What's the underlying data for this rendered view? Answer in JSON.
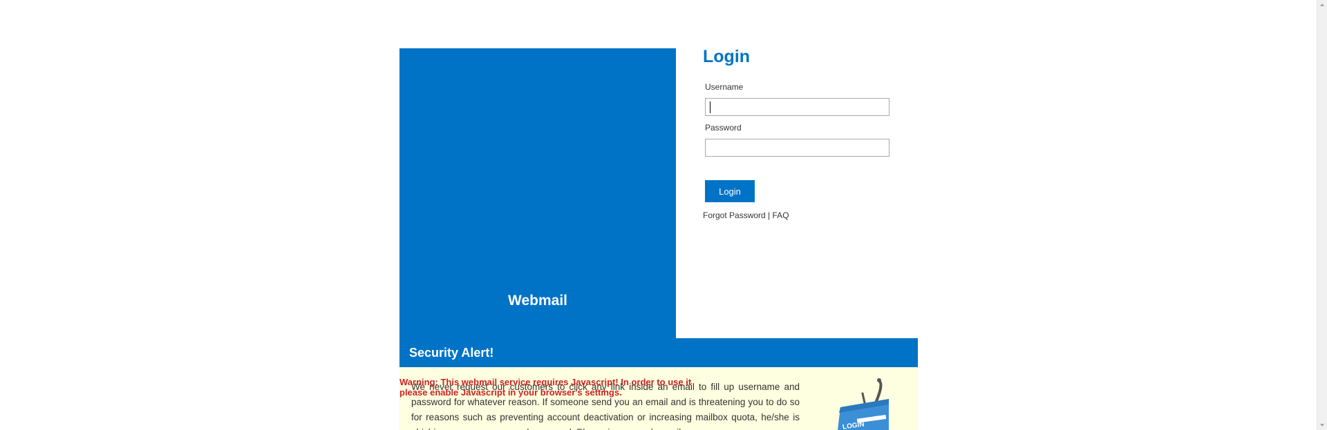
{
  "brand": {
    "title": "Webmail",
    "color": "#0073c6"
  },
  "login": {
    "title": "Login",
    "username_label": "Username",
    "username_value": "",
    "password_label": "Password",
    "password_value": "",
    "button_label": "Login",
    "forgot_password": "Forgot Password",
    "separator": "|",
    "faq": "FAQ"
  },
  "alert": {
    "title": "Security Alert!",
    "text": "We never request our customers to click any link inside an email to fill up username and password for whatever reason. If someone send you an email and is threatening you to do so for reasons such as preventing account deactivation or increasing mailbox quota, he/she is phishing your username and password. Please ignore such emails.",
    "icon": "login-hook-icon",
    "icon_text": "LOGIN",
    "background": "#fefee0"
  },
  "js_warning": "Warning: This webmail service requires Javascript! In order to use it please enable Javascript in your browser's settings."
}
